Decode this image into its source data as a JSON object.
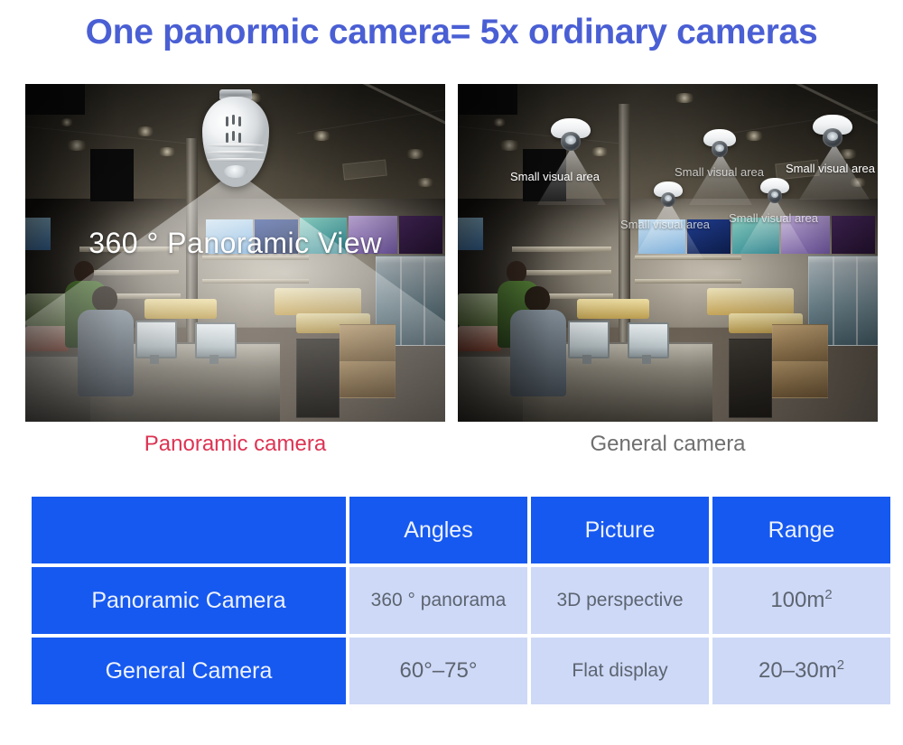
{
  "page": {
    "title": "One panormic camera= 5x ordinary cameras",
    "title_color": "#4a5fd4",
    "background": "#ffffff"
  },
  "comparison_images": {
    "left": {
      "overlay_text": "360 ° Panoramic View",
      "caption": "Panoramic camera",
      "caption_color": "#dd3353",
      "device": "panoramic-bulb-camera",
      "coverage": "one wide 360 degree cone"
    },
    "right": {
      "caption": "General camera",
      "caption_color": "#6f6f6f",
      "device": "dome-cameras",
      "camera_count": 5,
      "labels": [
        "Small visual area",
        "Small visual area",
        "Small visual area",
        "Small visual area",
        "Small visual area"
      ]
    }
  },
  "table": {
    "accent_blue": "#1659f0",
    "cell_blue": "#ced9f7",
    "headers": [
      "",
      "Angles",
      "Picture",
      "Range"
    ],
    "rows": [
      {
        "label": "Panoramic Camera",
        "angles": "360 ° panorama",
        "picture": "3D perspective",
        "range_value": "100m",
        "range_sup": "2"
      },
      {
        "label": "General Camera",
        "angles": "60°–75°",
        "picture": "Flat display",
        "range_value": "20–30m",
        "range_sup": "2"
      }
    ]
  }
}
